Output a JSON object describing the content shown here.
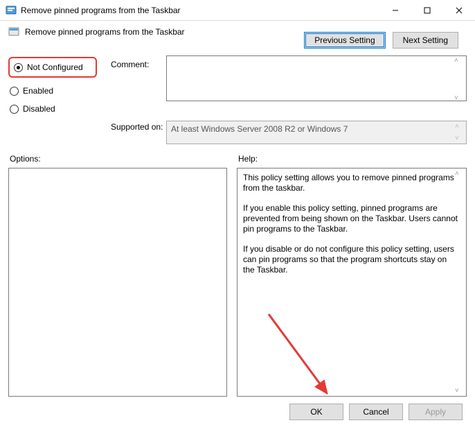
{
  "window": {
    "title": "Remove pinned programs from the Taskbar"
  },
  "banner": {
    "title": "Remove pinned programs from the Taskbar",
    "prev": "Previous Setting",
    "next": "Next Setting"
  },
  "state": {
    "not_configured": "Not Configured",
    "enabled": "Enabled",
    "disabled": "Disabled",
    "selected": "not_configured"
  },
  "fields": {
    "comment_label": "Comment:",
    "comment_value": "",
    "supported_label": "Supported on:",
    "supported_value": "At least Windows Server 2008 R2 or Windows 7"
  },
  "lower": {
    "options_label": "Options:",
    "help_label": "Help:",
    "help_p1": "This policy setting allows you to remove pinned programs from the taskbar.",
    "help_p2": "If you enable this policy setting, pinned programs are prevented from being shown on the Taskbar. Users cannot pin programs to the Taskbar.",
    "help_p3": "If you disable or do not configure this policy setting, users can pin programs so that the program shortcuts stay on the Taskbar."
  },
  "footer": {
    "ok": "OK",
    "cancel": "Cancel",
    "apply": "Apply"
  }
}
